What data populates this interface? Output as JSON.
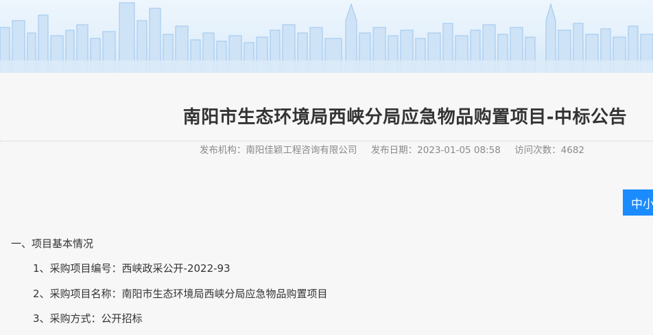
{
  "banner": {
    "description_icon": "city-skyline"
  },
  "article": {
    "title": "南阳市生态环境局西峡分局应急物品购置项目-中标公告",
    "meta": {
      "publisher": "发布机构：南阳佳颖工程咨询有限公司",
      "date": "发布日期：2023-01-05 08:58",
      "visits": "访问次数：4682"
    },
    "float_button_label": "中小",
    "section_heading": "一、项目基本情况",
    "items": [
      "1、采购项目编号：西峡政采公开-2022-93",
      "2、采购项目名称：南阳市生态环境局西峡分局应急物品购置项目",
      "3、采购方式：公开招标"
    ]
  },
  "colors": {
    "accent": "#1a8cff",
    "title": "#333333",
    "meta": "#8a8a8a",
    "background": "#f7f7f7"
  }
}
